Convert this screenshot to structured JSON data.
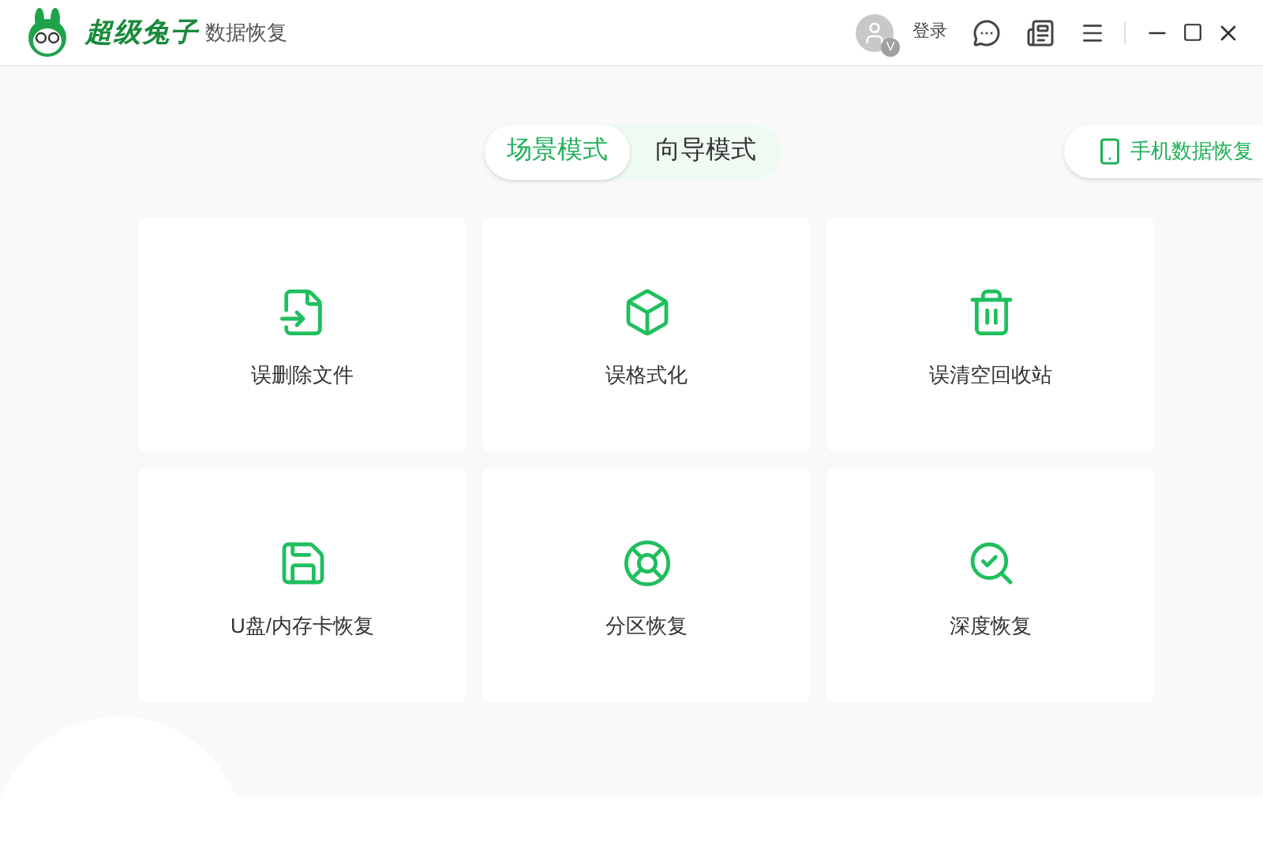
{
  "app": {
    "brand": "超级兔子",
    "product": "数据恢复"
  },
  "header": {
    "login": "登录",
    "avatar_badge": "V"
  },
  "mode_tabs": [
    {
      "label": "场景模式",
      "selected": true
    },
    {
      "label": "向导模式",
      "selected": false
    }
  ],
  "phone_button": {
    "label": "手机数据恢复"
  },
  "scenarios": [
    {
      "label": "误删除文件"
    },
    {
      "label": "误格式化"
    },
    {
      "label": "误清空回收站"
    },
    {
      "label": "U盘/内存卡恢复"
    },
    {
      "label": "分区恢复"
    },
    {
      "label": "深度恢复"
    }
  ]
}
